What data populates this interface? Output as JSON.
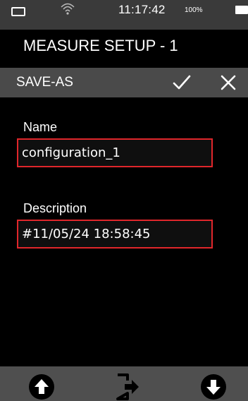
{
  "status": {
    "time": "11:17:42",
    "battery_percent": "100%"
  },
  "header": {
    "title": "MEASURE SETUP - 1"
  },
  "subheader": {
    "label": "SAVE-AS",
    "confirm_icon": "check-icon",
    "cancel_icon": "close-icon"
  },
  "form": {
    "name_label": "Name",
    "name_value": "configuration_1",
    "description_label": "Description",
    "description_value": "#11/05/24 18:58:45"
  },
  "bottom_bar": {
    "icons": [
      "arrow-up-circle-icon",
      "exit-icon",
      "arrow-down-circle-icon"
    ]
  },
  "colors": {
    "field_border": "#e0262b",
    "status_bar": "#3a3a3a",
    "subheader": "#4a4a4a",
    "bottom_bar": "#4f4f4f"
  }
}
